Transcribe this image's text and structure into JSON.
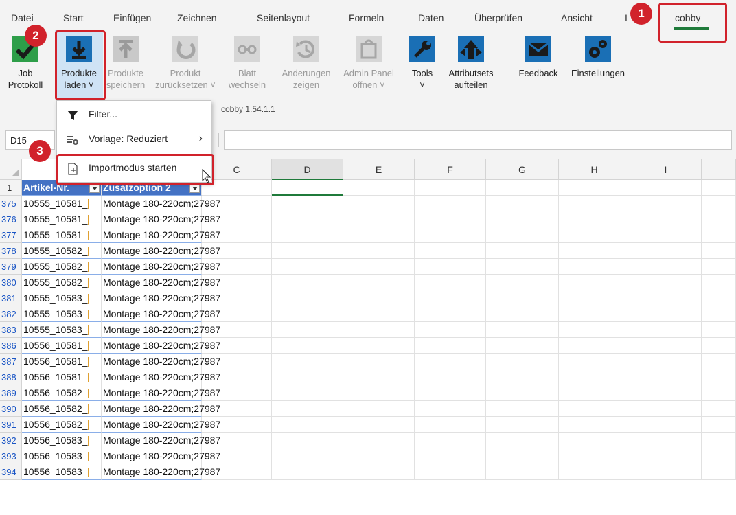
{
  "menu": {
    "tabs": [
      "Datei",
      "Start",
      "Einfügen",
      "Zeichnen",
      "Seitenlayout",
      "Formeln",
      "Daten",
      "Überprüfen",
      "Ansicht",
      "I",
      "cobby"
    ],
    "active_tab": "cobby"
  },
  "ribbon": {
    "job": {
      "line1": "Job",
      "line2": "Protokoll"
    },
    "load": {
      "line1": "Produkte",
      "line2": "laden ˅"
    },
    "save": {
      "line1": "Produkte",
      "line2": "speichern"
    },
    "reset": {
      "line1": "Produkt",
      "line2": "zurücksetzen ˅"
    },
    "switch": {
      "line1": "Blatt",
      "line2": "wechseln"
    },
    "changes": {
      "line1": "Änderungen",
      "line2": "zeigen"
    },
    "admin": {
      "line1": "Admin Panel",
      "line2": "öffnen ˅"
    },
    "tools": {
      "line1": "Tools",
      "line2": "˅"
    },
    "attr": {
      "line1": "Attributsets",
      "line2": "aufteilen"
    },
    "feedback": {
      "line1": "Feedback"
    },
    "settings": {
      "line1": "Einstellungen"
    },
    "group_caption": "cobby 1.54.1.1"
  },
  "namebox": "D15",
  "dropdown": {
    "filter": "Filter...",
    "template": "Vorlage: Reduziert",
    "import": "Importmodus starten"
  },
  "columns": [
    "C",
    "D",
    "E",
    "F",
    "G",
    "H",
    "I"
  ],
  "header_row": {
    "num": "1",
    "col_a": "Artikel-Nr.",
    "col_b": "Zusatzoption 2"
  },
  "rows": [
    {
      "num": "375",
      "a": "10555_10581_",
      "b": "Montage 180-220cm;27987"
    },
    {
      "num": "376",
      "a": "10555_10581_",
      "b": "Montage 180-220cm;27987"
    },
    {
      "num": "377",
      "a": "10555_10581_",
      "b": "Montage 180-220cm;27987"
    },
    {
      "num": "378",
      "a": "10555_10582_",
      "b": "Montage 180-220cm;27987"
    },
    {
      "num": "379",
      "a": "10555_10582_",
      "b": "Montage 180-220cm;27987"
    },
    {
      "num": "380",
      "a": "10555_10582_",
      "b": "Montage 180-220cm;27987"
    },
    {
      "num": "381",
      "a": "10555_10583_",
      "b": "Montage 180-220cm;27987"
    },
    {
      "num": "382",
      "a": "10555_10583_",
      "b": "Montage 180-220cm;27987"
    },
    {
      "num": "383",
      "a": "10555_10583_",
      "b": "Montage 180-220cm;27987"
    },
    {
      "num": "386",
      "a": "10556_10581_",
      "b": "Montage 180-220cm;27987"
    },
    {
      "num": "387",
      "a": "10556_10581_",
      "b": "Montage 180-220cm;27987"
    },
    {
      "num": "388",
      "a": "10556_10581_",
      "b": "Montage 180-220cm;27987"
    },
    {
      "num": "389",
      "a": "10556_10582_",
      "b": "Montage 180-220cm;27987"
    },
    {
      "num": "390",
      "a": "10556_10582_",
      "b": "Montage 180-220cm;27987"
    },
    {
      "num": "391",
      "a": "10556_10582_",
      "b": "Montage 180-220cm;27987"
    },
    {
      "num": "392",
      "a": "10556_10583_",
      "b": "Montage 180-220cm;27987"
    },
    {
      "num": "393",
      "a": "10556_10583_",
      "b": "Montage 180-220cm;27987"
    },
    {
      "num": "394",
      "a": "10556_10583_",
      "b": "Montage 180-220cm;27987"
    }
  ],
  "callouts": [
    "1",
    "2",
    "3"
  ],
  "colors": {
    "accent_green": "#1f7a3a",
    "callout_red": "#d1222b",
    "table_header_blue": "#4472c4",
    "icon_blue": "#1a6fb5"
  }
}
